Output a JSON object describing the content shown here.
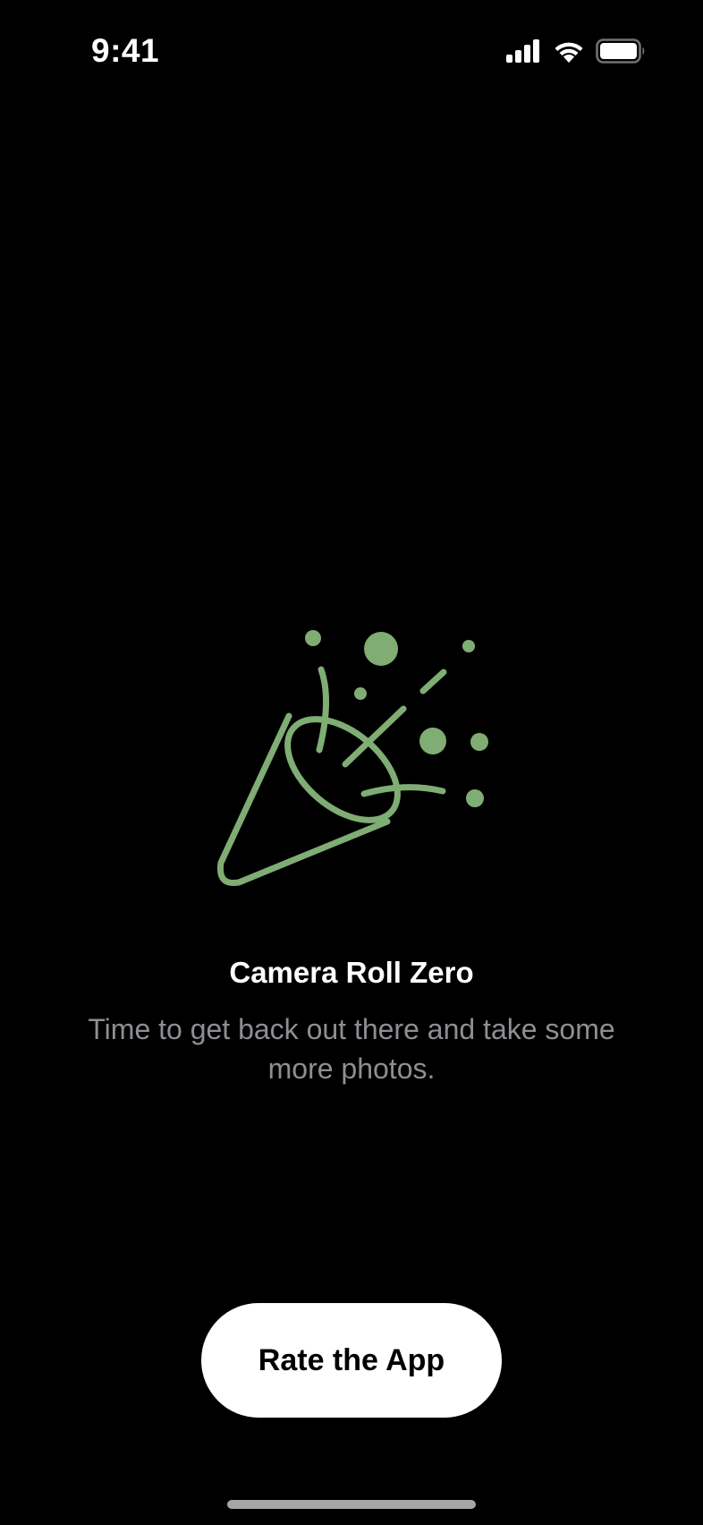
{
  "status_bar": {
    "time": "9:41",
    "signal_icon": "cellular-signal-icon",
    "wifi_icon": "wifi-icon",
    "battery_icon": "battery-icon"
  },
  "empty_state": {
    "illustration_icon": "party-popper-icon",
    "illustration_color": "#7fad74",
    "title": "Camera Roll Zero",
    "message": "Time to get back out there and take some more photos."
  },
  "actions": {
    "rate_button_label": "Rate the App"
  }
}
